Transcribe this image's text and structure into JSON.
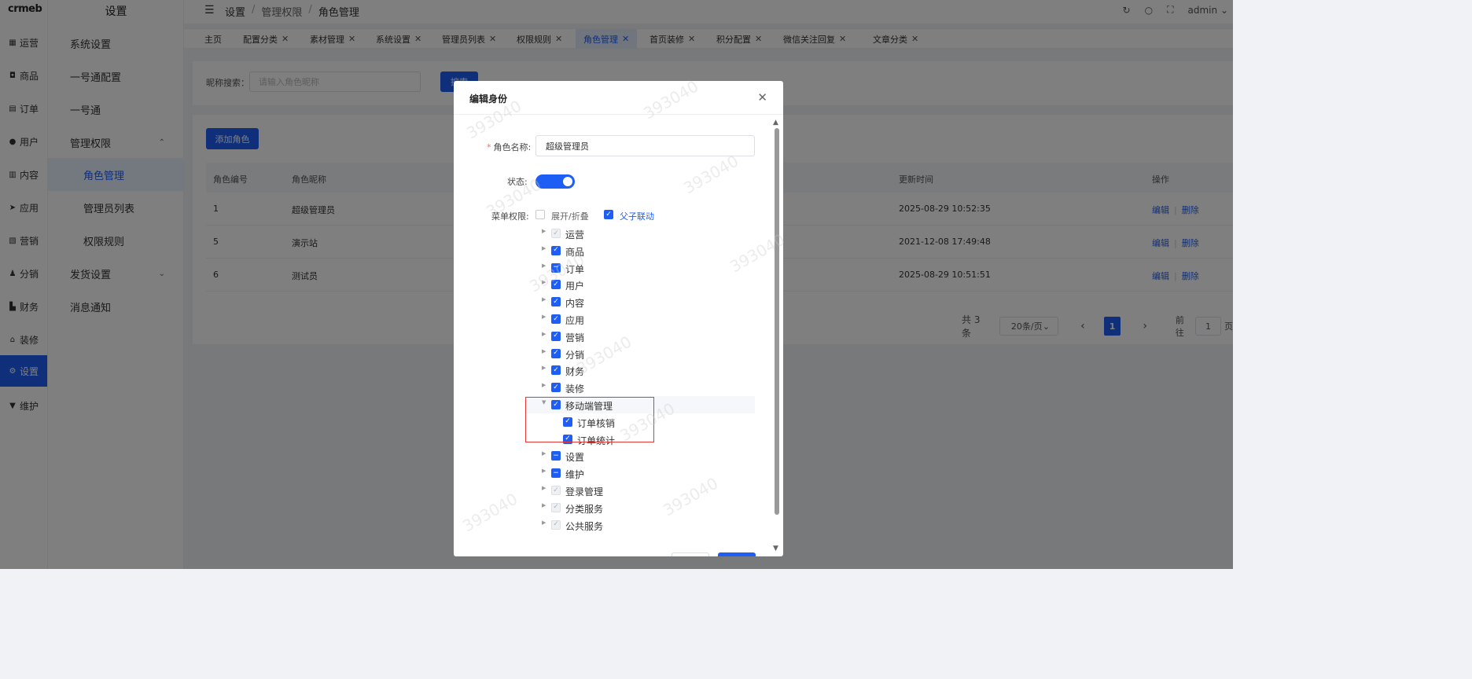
{
  "app": {
    "logo": "crmeb",
    "admin_user": "admin"
  },
  "rail": [
    {
      "label": "运营",
      "icon": "grid-icon"
    },
    {
      "label": "商品",
      "icon": "bag-icon"
    },
    {
      "label": "订单",
      "icon": "order-icon"
    },
    {
      "label": "用户",
      "icon": "user-icon"
    },
    {
      "label": "内容",
      "icon": "content-icon"
    },
    {
      "label": "应用",
      "icon": "app-icon"
    },
    {
      "label": "营销",
      "icon": "marketing-icon"
    },
    {
      "label": "分销",
      "icon": "distribution-icon"
    },
    {
      "label": "财务",
      "icon": "finance-icon"
    },
    {
      "label": "装修",
      "icon": "home-icon"
    },
    {
      "label": "设置",
      "icon": "gear-icon",
      "active": true
    },
    {
      "label": "维护",
      "icon": "maintain-icon"
    }
  ],
  "submenu": {
    "title": "设置",
    "items": [
      {
        "label": "系统设置"
      },
      {
        "label": "一号通配置"
      },
      {
        "label": "一号通"
      },
      {
        "label": "管理权限",
        "arrow": "⌃"
      },
      {
        "label": "角色管理",
        "child": true,
        "active": true
      },
      {
        "label": "管理员列表",
        "child": true
      },
      {
        "label": "权限规则",
        "child": true
      },
      {
        "label": "发货设置",
        "arrow": "⌄"
      },
      {
        "label": "消息通知"
      }
    ]
  },
  "header": {
    "breadcrumb": [
      "设置",
      "管理权限",
      "角色管理"
    ]
  },
  "tabs": [
    {
      "label": "主页",
      "closable": false
    },
    {
      "label": "配置分类",
      "closable": true
    },
    {
      "label": "素材管理",
      "closable": true
    },
    {
      "label": "系统设置",
      "closable": true
    },
    {
      "label": "管理员列表",
      "closable": true
    },
    {
      "label": "权限规则",
      "closable": true
    },
    {
      "label": "角色管理",
      "closable": true,
      "active": true
    },
    {
      "label": "首页装修",
      "closable": true
    },
    {
      "label": "积分配置",
      "closable": true
    },
    {
      "label": "微信关注回复",
      "closable": true
    },
    {
      "label": "文章分类",
      "closable": true
    }
  ],
  "search": {
    "label": "昵称搜索：",
    "placeholder": "请输入角色昵称",
    "button": "搜索"
  },
  "table": {
    "add_button": "添加角色",
    "columns": {
      "id": "角色编号",
      "name": "角色昵称",
      "updated": "更新时间",
      "actions": "操作"
    },
    "rows": [
      {
        "id": "1",
        "name": "超级管理员",
        "updated": "2025-08-29 10:52:35"
      },
      {
        "id": "5",
        "name": "演示站",
        "updated": "2021-12-08 17:49:48"
      },
      {
        "id": "6",
        "name": "测试员",
        "updated": "2025-08-29 10:51:51"
      }
    ],
    "edit_label": "编辑",
    "delete_label": "删除"
  },
  "pagination": {
    "total": "共 3 条",
    "page_size": "20条/页",
    "current_page": "1",
    "goto_label": "前往",
    "goto_value": "1",
    "page_unit": "页"
  },
  "watermark": "393040",
  "dialog": {
    "title": "编辑身份",
    "name_label": "角色名称:",
    "name_value": "超级管理员",
    "status_label": "状态:",
    "status_on": true,
    "menu_label": "菜单权限:",
    "expand_label": "展开/折叠",
    "expand_checked": false,
    "linkage_label": "父子联动",
    "linkage_checked": true,
    "tree": [
      {
        "label": "运营",
        "state": "disabled"
      },
      {
        "label": "商品",
        "state": "checked"
      },
      {
        "label": "订单",
        "state": "indeterminate"
      },
      {
        "label": "用户",
        "state": "checked"
      },
      {
        "label": "内容",
        "state": "checked"
      },
      {
        "label": "应用",
        "state": "checked"
      },
      {
        "label": "营销",
        "state": "checked"
      },
      {
        "label": "分销",
        "state": "checked"
      },
      {
        "label": "财务",
        "state": "checked"
      },
      {
        "label": "装修",
        "state": "checked"
      },
      {
        "label": "移动端管理",
        "state": "checked",
        "expanded": true,
        "highlight": true
      },
      {
        "label": "订单核销",
        "state": "checked",
        "child": true
      },
      {
        "label": "订单统计",
        "state": "checked",
        "child": true
      },
      {
        "label": "设置",
        "state": "indeterminate"
      },
      {
        "label": "维护",
        "state": "indeterminate"
      },
      {
        "label": "登录管理",
        "state": "disabled"
      },
      {
        "label": "分类服务",
        "state": "disabled"
      },
      {
        "label": "公共服务",
        "state": "disabled"
      }
    ],
    "colors": {
      "primary": "#1e5ef5",
      "highlight_box": "#e53935"
    }
  }
}
